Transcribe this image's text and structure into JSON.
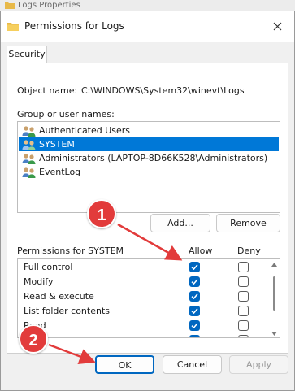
{
  "background_window": {
    "title": "Logs Properties"
  },
  "dialog": {
    "title": "Permissions for Logs",
    "tab_security": "Security",
    "object_name_label": "Object name:",
    "object_name_value": "C:\\WINDOWS\\System32\\winevt\\Logs",
    "group_label": "Group or user names:",
    "users": [
      {
        "name": "Authenticated Users",
        "selected": false
      },
      {
        "name": "SYSTEM",
        "selected": true
      },
      {
        "name": "Administrators (LAPTOP-8D66K528\\Administrators)",
        "selected": false
      },
      {
        "name": "EventLog",
        "selected": false
      }
    ],
    "add_label": "Add...",
    "remove_label": "Remove",
    "permissions_for": "Permissions for SYSTEM",
    "allow_header": "Allow",
    "deny_header": "Deny",
    "permissions": [
      {
        "name": "Full control",
        "allow": true,
        "deny": false
      },
      {
        "name": "Modify",
        "allow": true,
        "deny": false
      },
      {
        "name": "Read & execute",
        "allow": true,
        "deny": false
      },
      {
        "name": "List folder contents",
        "allow": true,
        "deny": false
      },
      {
        "name": "Read",
        "allow": true,
        "deny": false
      }
    ],
    "ok_label": "OK",
    "cancel_label": "Cancel",
    "apply_label": "Apply"
  },
  "annotations": {
    "step1": "1",
    "step2": "2"
  },
  "colors": {
    "accent": "#0067c0",
    "selection": "#0078d7",
    "badge": "#e23b3b"
  }
}
